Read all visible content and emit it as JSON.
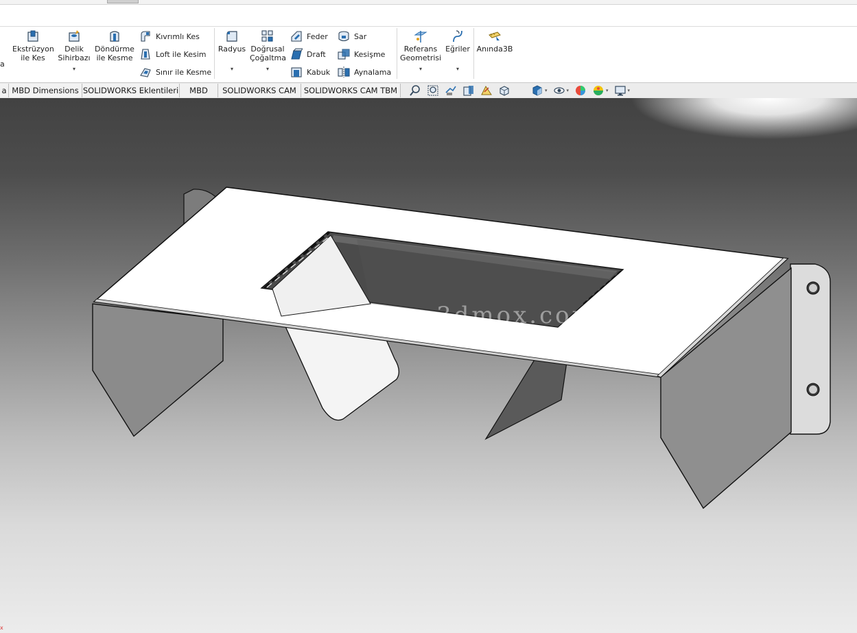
{
  "ribbon": {
    "left_fragment": "a",
    "ekstruzyon_label": "Ekstrüzyon\nile Kes",
    "delik_label": "Delik\nSihirbazı",
    "dondurme_label": "Döndürme\nile Kesme",
    "kivrimli_label": "Kıvrımlı Kes",
    "loft_label": "Loft ile Kesim",
    "sinir_label": "Sınır ile Kesme",
    "radyus_label": "Radyus",
    "dogrusal_label": "Doğrusal\nÇoğaltma",
    "feder_label": "Feder",
    "draft_label": "Draft",
    "kabuk_label": "Kabuk",
    "sar_label": "Sar",
    "kesisme_label": "Kesişme",
    "aynalama_label": "Aynalama",
    "referans_label": "Referans\nGeometrisi",
    "egriler_label": "Eğriler",
    "aninda_label": "Anında3B",
    "caret": "▾"
  },
  "tabs": {
    "fragment": "a",
    "mbd_dimensions": "MBD Dimensions",
    "sw_eklentileri": "SOLIDWORKS Eklentileri",
    "mbd": "MBD",
    "sw_cam": "SOLIDWORKS CAM",
    "sw_cam_tbm": "SOLIDWORKS CAM TBM"
  },
  "hud": {
    "caret": "▾"
  },
  "viewport": {
    "watermark": "3dmox.com",
    "corner_marker": "x"
  },
  "colors": {
    "icon_blue": "#2a6fb0",
    "icon_dark": "#34495e",
    "part_face": "#ffffff",
    "part_side": "#8a8a8a",
    "part_edge": "#111111"
  }
}
